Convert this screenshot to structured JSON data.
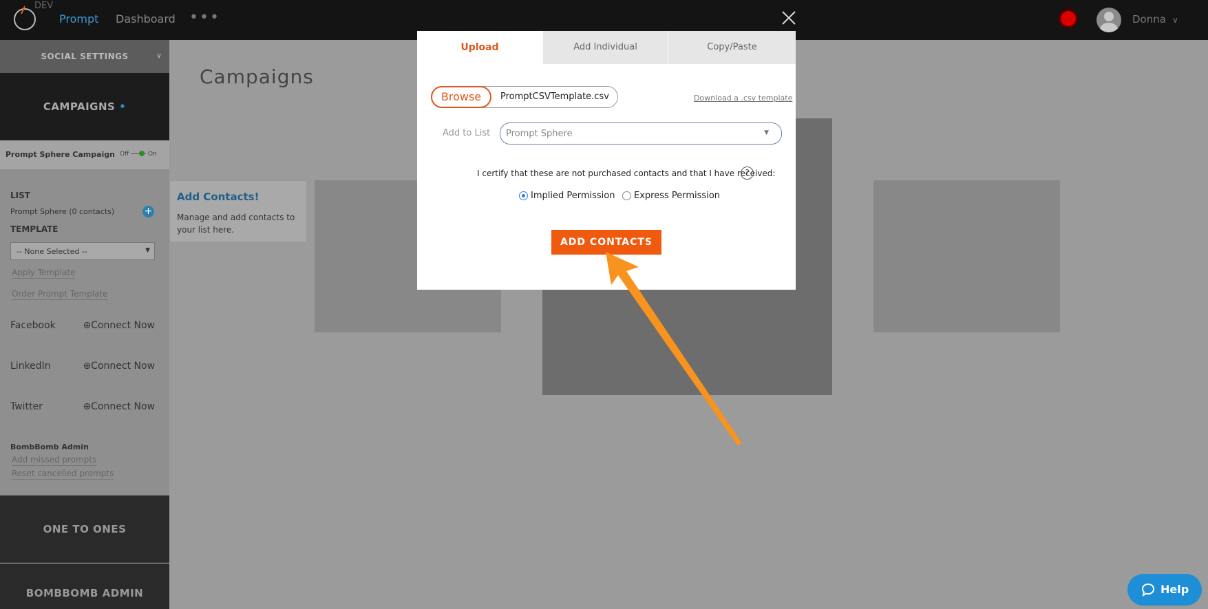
{
  "topbar": {
    "env_label": "DEV",
    "nav": [
      "Prompt",
      "Dashboard"
    ],
    "more_label": "•••",
    "user_name": "Donna"
  },
  "sidebar": {
    "social_settings": "SOCIAL SETTINGS",
    "campaigns": "CAMPAIGNS",
    "campaigns_dot": "•",
    "campaign_name": "Prompt Sphere Campaign",
    "toggle_off": "Off",
    "toggle_on": "On",
    "list_label": "LIST",
    "list_value": "Prompt Sphere (0 contacts)",
    "template_label": "TEMPLATE",
    "template_select": "-- None Selected --",
    "apply_template": "Apply Template",
    "order_template": "Order Prompt Template",
    "socials": [
      {
        "name": "Facebook",
        "action": "⊕Connect Now"
      },
      {
        "name": "LinkedIn",
        "action": "⊕Connect Now"
      },
      {
        "name": "Twitter",
        "action": "⊕Connect Now"
      }
    ],
    "admin_label": "BombBomb Admin",
    "add_missed": "Add missed prompts",
    "reset_cancelled": "Reset cancelled prompts",
    "one_to_ones": "ONE TO ONES",
    "bombbomb_admin": "BOMBBOMB ADMIN"
  },
  "main": {
    "title": "Campaigns",
    "tooltip_title": "Add Contacts!",
    "tooltip_text": "Manage and add contacts to your list here."
  },
  "modal": {
    "tabs": [
      "Upload",
      "Add Individual",
      "Copy/Paste"
    ],
    "browse_label": "Browse",
    "file_name": "PromptCSVTemplate.csv",
    "download_link": "Download a .csv template",
    "add_to_list_label": "Add to List",
    "list_selected": "Prompt Sphere",
    "certify_text": "I certify that these are not purchased contacts and that I have received:",
    "help_mark": "?",
    "permissions": [
      {
        "label": "Implied Permission",
        "checked": true
      },
      {
        "label": "Express Permission",
        "checked": false
      }
    ],
    "add_button": "ADD CONTACTS"
  },
  "help_widget": {
    "label": "Help"
  },
  "colors": {
    "accent": "#f05a0f",
    "link_blue": "#3d9ad8",
    "annotation_arrow": "#f7931e"
  }
}
